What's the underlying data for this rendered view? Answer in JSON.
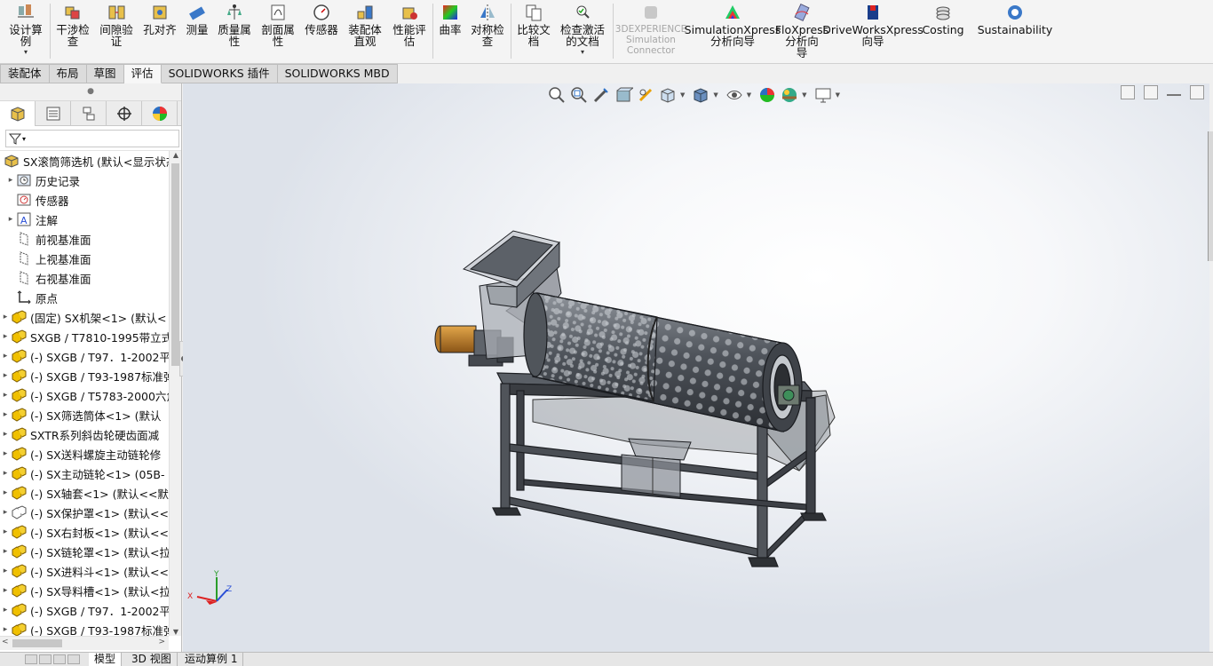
{
  "ribbon": {
    "buttons": [
      {
        "label": "设计算\n例",
        "icon": "design-study-icon"
      },
      {
        "label": "干涉检\n查",
        "icon": "interference-check-icon"
      },
      {
        "label": "间隙验\n证",
        "icon": "clearance-verification-icon"
      },
      {
        "label": "孔对齐",
        "icon": "hole-alignment-icon"
      },
      {
        "label": "测量",
        "icon": "measure-icon"
      },
      {
        "label": "质量属\n性",
        "icon": "mass-properties-icon"
      },
      {
        "label": "剖面属\n性",
        "icon": "section-properties-icon"
      },
      {
        "label": "传感器",
        "icon": "sensor-icon"
      },
      {
        "label": "装配体\n直观",
        "icon": "assembly-visualization-icon"
      },
      {
        "label": "性能评\n估",
        "icon": "performance-evaluation-icon"
      },
      {
        "label": "曲率",
        "icon": "curvature-icon"
      },
      {
        "label": "对称检\n查",
        "icon": "symmetry-check-icon"
      },
      {
        "label": "比较文\n档",
        "icon": "compare-documents-icon"
      },
      {
        "label": "检查激活\n的文档",
        "icon": "check-active-document-icon"
      },
      {
        "label": "3DEXPERIENCE\nSimulation\nConnector",
        "icon": "3dexperience-icon"
      },
      {
        "label": "SimulationXpress\n分析向导",
        "icon": "simulationxpress-icon"
      },
      {
        "label": "FloXpress\n分析向\n导",
        "icon": "floxpress-icon"
      },
      {
        "label": "DriveWorksXpress\n向导",
        "icon": "driveworksxpress-icon"
      },
      {
        "label": "Costing",
        "icon": "costing-icon"
      },
      {
        "label": "Sustainability",
        "icon": "sustainability-icon"
      }
    ]
  },
  "cm_tabs": [
    "装配体",
    "布局",
    "草图",
    "评估",
    "SOLIDWORKS 插件",
    "SOLIDWORKS MBD"
  ],
  "tree": {
    "items": [
      {
        "label": "SX滚筒筛选机 (默认<显示状态",
        "icon": "assembly-icon"
      },
      {
        "label": "历史记录",
        "icon": "history-icon"
      },
      {
        "label": "传感器",
        "icon": "sensor-folder-icon"
      },
      {
        "label": "注解",
        "icon": "annotations-icon"
      },
      {
        "label": "前视基准面",
        "icon": "plane-icon"
      },
      {
        "label": "上视基准面",
        "icon": "plane-icon"
      },
      {
        "label": "右视基准面",
        "icon": "plane-icon"
      },
      {
        "label": "原点",
        "icon": "origin-icon"
      },
      {
        "label": "(固定) SX机架<1> (默认<",
        "icon": "subassembly-icon"
      },
      {
        "label": "SXGB / T7810-1995带立式",
        "icon": "subassembly-icon"
      },
      {
        "label": "(-) SXGB / T97．1-2002平",
        "icon": "subassembly-icon"
      },
      {
        "label": "(-) SXGB / T93-1987标准弹",
        "icon": "subassembly-icon"
      },
      {
        "label": "(-) SXGB / T5783-2000六角",
        "icon": "subassembly-icon"
      },
      {
        "label": "(-) SX筛选筒体<1> (默认",
        "icon": "subassembly-icon"
      },
      {
        "label": "SXTR系列斜齿轮硬齿面减",
        "icon": "subassembly-icon"
      },
      {
        "label": "(-) SX送料螺旋主动链轮修",
        "icon": "subassembly-icon"
      },
      {
        "label": "(-) SX主动链轮<1> (05B-",
        "icon": "subassembly-icon"
      },
      {
        "label": "(-) SX轴套<1> (默认<<默",
        "icon": "subassembly-icon"
      },
      {
        "label": "(-) SX保护罩<1> (默认<<",
        "icon": "part-outline-icon"
      },
      {
        "label": "(-) SX右封板<1> (默认<<",
        "icon": "subassembly-icon"
      },
      {
        "label": "(-) SX链轮罩<1> (默认<拉",
        "icon": "subassembly-icon"
      },
      {
        "label": "(-) SX进料斗<1> (默认<<",
        "icon": "subassembly-icon"
      },
      {
        "label": "(-) SX导料槽<1> (默认<拉",
        "icon": "subassembly-icon"
      },
      {
        "label": "(-) SXGB / T97．1-2002平",
        "icon": "subassembly-icon"
      },
      {
        "label": "(-) SXGB / T93-1987标准弹",
        "icon": "subassembly-icon"
      }
    ]
  },
  "bottom_tabs": [
    "模型",
    "3D 视图",
    "运动算例 1"
  ],
  "triad": {
    "x": "X",
    "y": "Y",
    "z": "Z"
  },
  "colors": {
    "accent_yellow": "#f0c000",
    "accent_blue": "#2a6fc4"
  }
}
